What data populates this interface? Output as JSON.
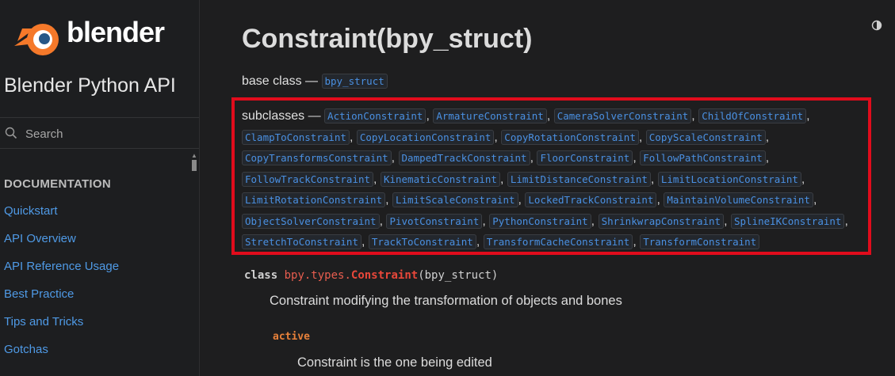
{
  "sidebar": {
    "logo_text": "blender",
    "project_title": "Blender Python API",
    "search_placeholder": "Search",
    "caption": "DOCUMENTATION",
    "items": [
      {
        "label": "Quickstart"
      },
      {
        "label": "API Overview"
      },
      {
        "label": "API Reference Usage"
      },
      {
        "label": "Best Practice"
      },
      {
        "label": "Tips and Tricks"
      },
      {
        "label": "Gotchas"
      }
    ]
  },
  "main": {
    "title": "Constraint(bpy_struct)",
    "base_label": "base class —",
    "base_ref": "bpy_struct",
    "subclasses_label": "subclasses —",
    "subclasses": [
      "ActionConstraint",
      "ArmatureConstraint",
      "CameraSolverConstraint",
      "ChildOfConstraint",
      "ClampToConstraint",
      "CopyLocationConstraint",
      "CopyRotationConstraint",
      "CopyScaleConstraint",
      "CopyTransformsConstraint",
      "DampedTrackConstraint",
      "FloorConstraint",
      "FollowPathConstraint",
      "FollowTrackConstraint",
      "KinematicConstraint",
      "LimitDistanceConstraint",
      "LimitLocationConstraint",
      "LimitRotationConstraint",
      "LimitScaleConstraint",
      "LockedTrackConstraint",
      "MaintainVolumeConstraint",
      "ObjectSolverConstraint",
      "PivotConstraint",
      "PythonConstraint",
      "ShrinkwrapConstraint",
      "SplineIKConstraint",
      "StretchToConstraint",
      "TrackToConstraint",
      "TransformCacheConstraint",
      "TransformConstraint"
    ],
    "signature": {
      "keyword": "class",
      "module": "bpy.types.",
      "name": "Constraint",
      "args": "(bpy_struct)"
    },
    "description": "Constraint modifying the transformation of objects and bones",
    "attribute": {
      "name": "active",
      "description": "Constraint is the one being edited"
    }
  },
  "colors": {
    "background": "#1e1e1f",
    "link": "#4f9ae6",
    "highlight_box": "#e10c1c",
    "class_name": "#e8473a",
    "attribute": "#e8813a"
  },
  "icons": [
    "blender-logo-icon",
    "search-icon",
    "theme-toggle-icon"
  ]
}
